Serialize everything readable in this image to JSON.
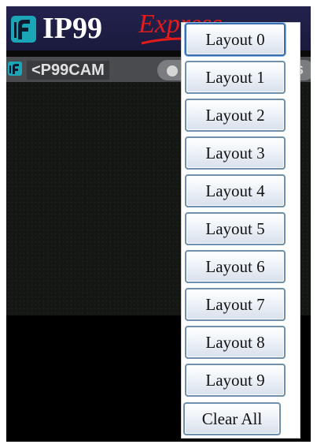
{
  "header": {
    "brand_name": "IP99",
    "brand_sub": "Express",
    "accent_color": "#1aa6b7",
    "sub_color": "#e21b1b"
  },
  "camera_bar": {
    "camera_name": "<P99CAM",
    "status_text": "s"
  },
  "layout_menu": {
    "items": [
      {
        "label": "Layout 0"
      },
      {
        "label": "Layout 1"
      },
      {
        "label": "Layout 2"
      },
      {
        "label": "Layout 3"
      },
      {
        "label": "Layout 4"
      },
      {
        "label": "Layout 5"
      },
      {
        "label": "Layout 6"
      },
      {
        "label": "Layout 7"
      },
      {
        "label": "Layout 8"
      },
      {
        "label": "Layout 9"
      }
    ],
    "clear_label": "Clear All"
  }
}
